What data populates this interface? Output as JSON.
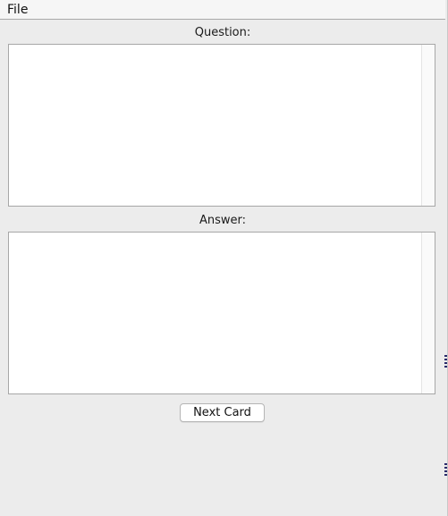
{
  "menubar": {
    "file_label": "File"
  },
  "question": {
    "label": "Question:",
    "value": ""
  },
  "answer": {
    "label": "Answer:",
    "value": ""
  },
  "actions": {
    "next_card_label": "Next Card"
  },
  "colors": {
    "window_bg": "#ececec",
    "menubar_bg": "#f6f6f6",
    "field_bg": "#ffffff",
    "field_border": "#a7a7a7"
  }
}
